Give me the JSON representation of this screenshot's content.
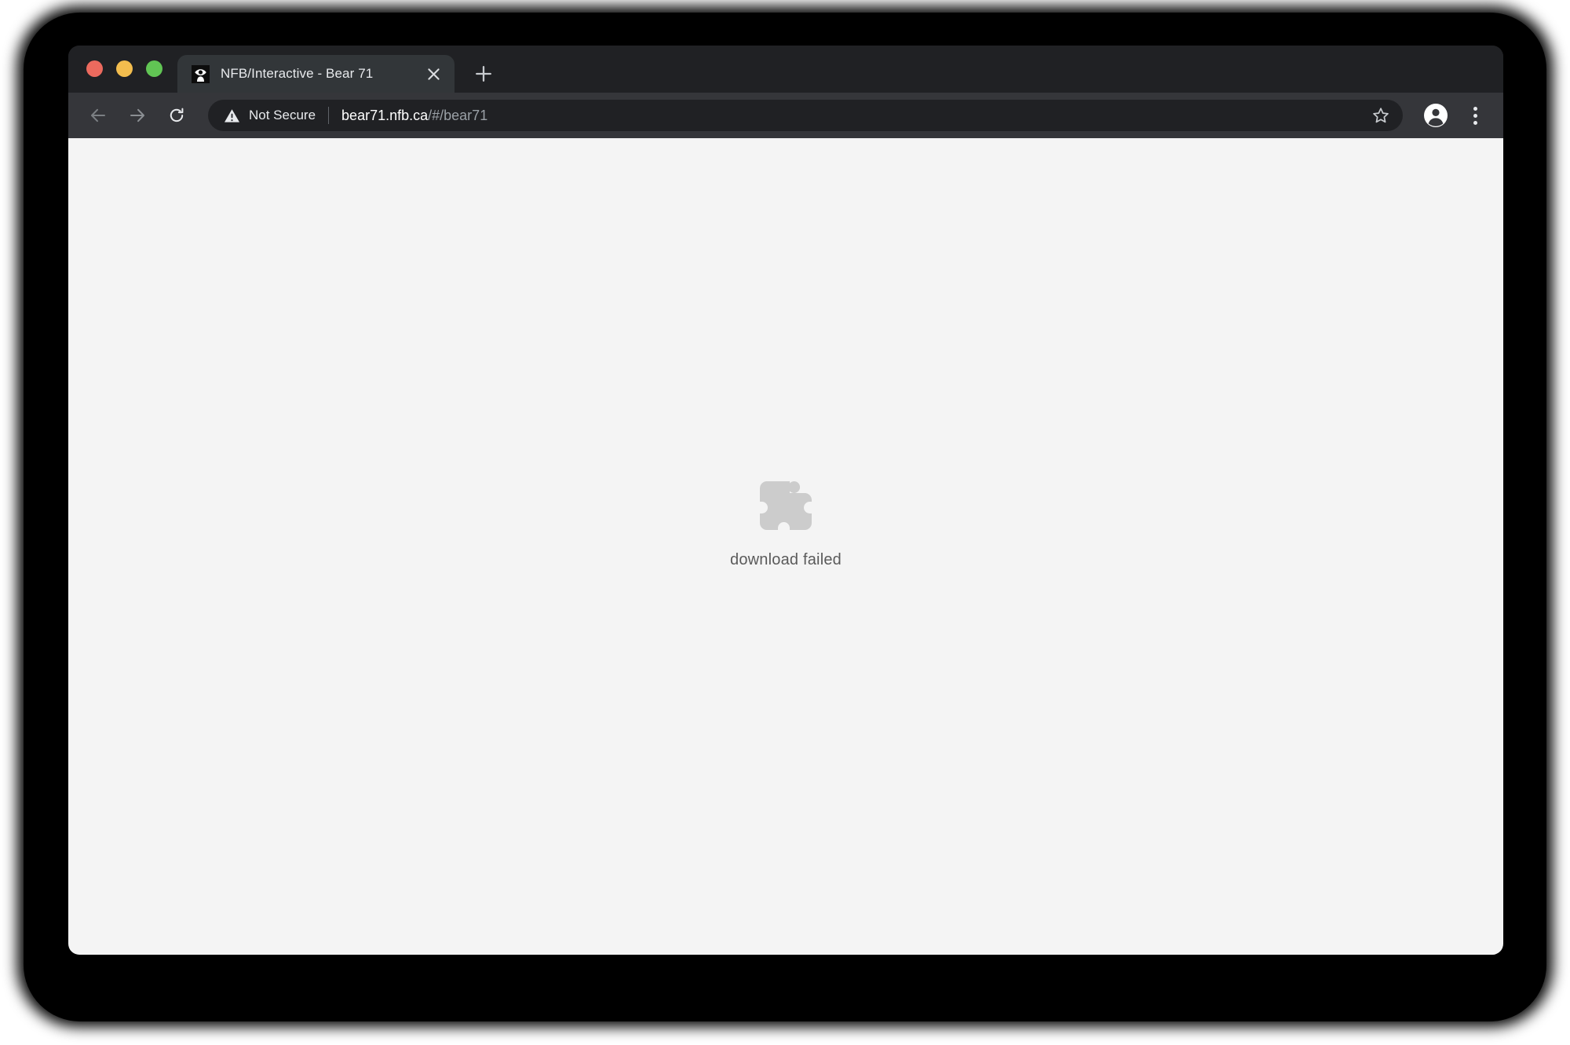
{
  "window": {
    "traffic_lights": [
      {
        "name": "close",
        "color": "#ec6a5e"
      },
      {
        "name": "minimize",
        "color": "#f3bd4e"
      },
      {
        "name": "zoom",
        "color": "#61c554"
      }
    ]
  },
  "tabstrip": {
    "tabs": [
      {
        "title": "NFB/Interactive - Bear 71",
        "favicon": "nfb-eye-logo-icon",
        "active": true,
        "close_label": "×"
      }
    ],
    "new_tab_label": "+"
  },
  "toolbar": {
    "back_icon": "arrow-left-icon",
    "forward_icon": "arrow-right-icon",
    "reload_icon": "reload-icon",
    "security": {
      "icon": "warning-triangle-icon",
      "label": "Not Secure"
    },
    "url": {
      "host": "bear71.nfb.ca",
      "path": "/#/bear71",
      "full": "bear71.nfb.ca/#/bear71"
    },
    "bookmark_icon": "star-outline-icon",
    "profile_icon": "account-circle-icon",
    "menu_icon": "three-dot-menu-icon"
  },
  "page": {
    "background_color": "#f4f4f4",
    "plugin_placeholder": {
      "icon": "puzzle-piece-icon",
      "icon_color": "#cccccc",
      "message": "download failed",
      "text_color": "#5a5a5a"
    }
  }
}
